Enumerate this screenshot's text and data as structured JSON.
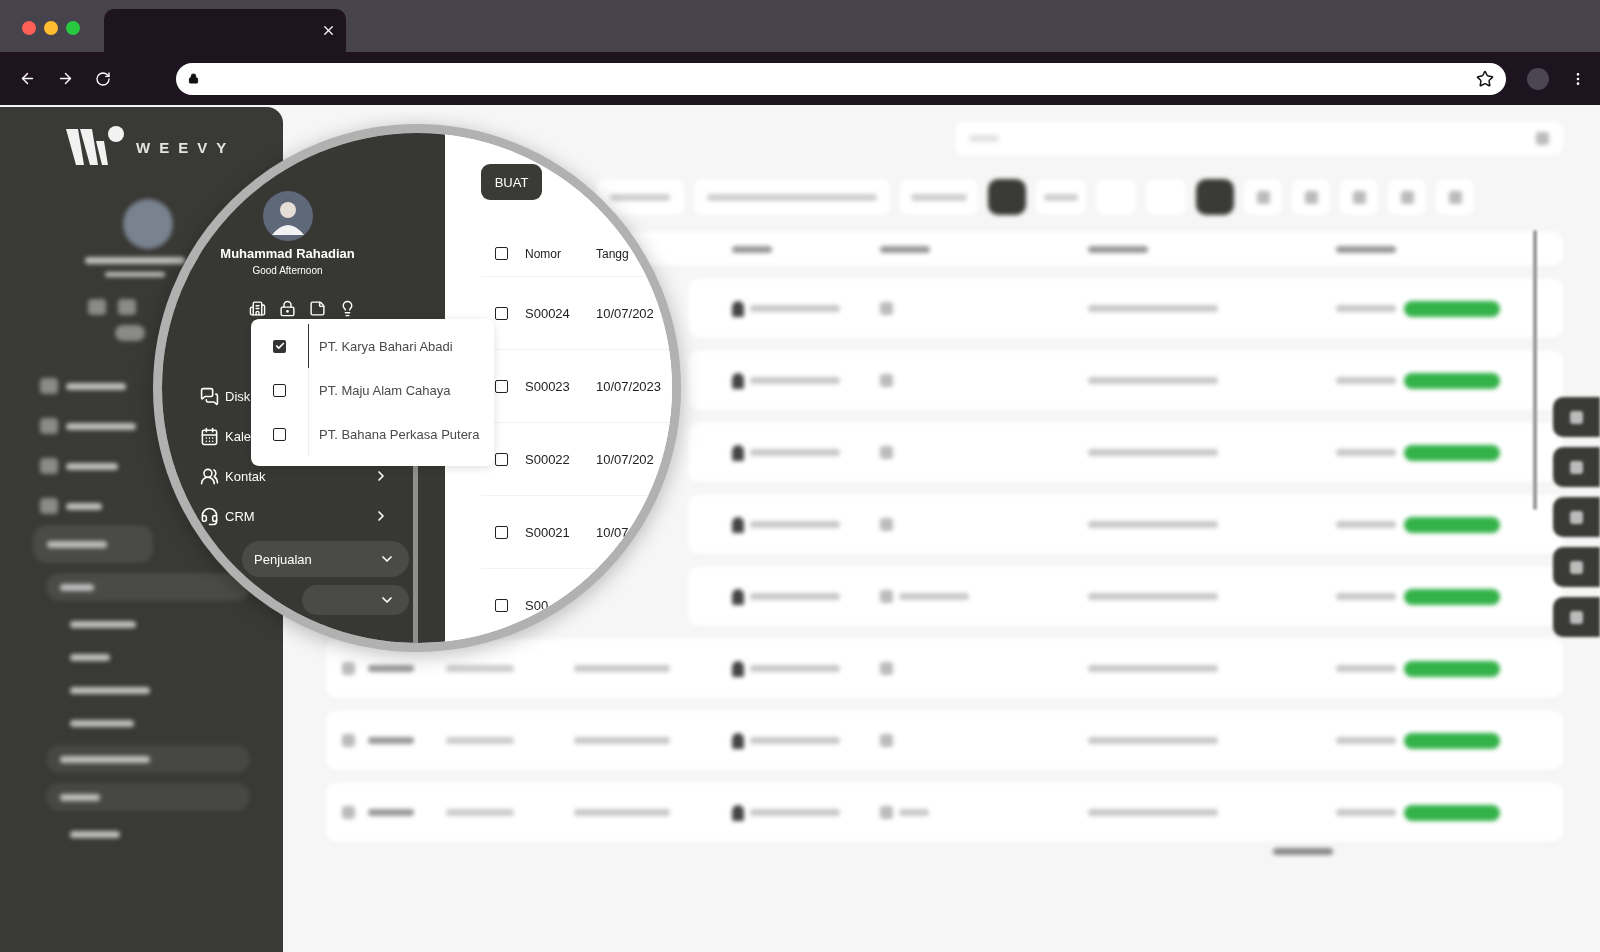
{
  "sidebar": {
    "logo_text": "WEEVY"
  },
  "magnifier": {
    "profile": {
      "name": "Muhammad Rahadian",
      "greeting": "Good Afternoon"
    },
    "company_menu": [
      {
        "label": "PT. Karya Bahari Abadi",
        "checked": true,
        "selected": true
      },
      {
        "label": "PT. Maju Alam Cahaya",
        "checked": false,
        "selected": false
      },
      {
        "label": "PT. Bahana Perkasa Putera",
        "checked": false,
        "selected": false
      }
    ],
    "menu": [
      {
        "label": "Disk",
        "kind": "link",
        "selected": false
      },
      {
        "label": "Kale",
        "kind": "link",
        "selected": false
      },
      {
        "label": "Kontak",
        "kind": "group",
        "expanded": false,
        "selected": false
      },
      {
        "label": "CRM",
        "kind": "group",
        "expanded": false,
        "selected": false
      },
      {
        "label": "Penjualan",
        "kind": "group",
        "expanded": true,
        "selected": true
      },
      {
        "kind": "subgroup",
        "expanded": true,
        "selected": false
      }
    ],
    "create_button": "BUAT",
    "table": {
      "header_checked": false,
      "columns": [
        "Nomor",
        "Tangg"
      ],
      "rows": [
        {
          "number": "S00024",
          "date": "10/07/202",
          "checked": false
        },
        {
          "number": "S00023",
          "date": "10/07/2023",
          "checked": false
        },
        {
          "number": "S00022",
          "date": "10/07/202",
          "checked": false
        },
        {
          "number": "S00021",
          "date": "10/07",
          "checked": false
        },
        {
          "number": "S00",
          "checked": false
        }
      ]
    }
  }
}
